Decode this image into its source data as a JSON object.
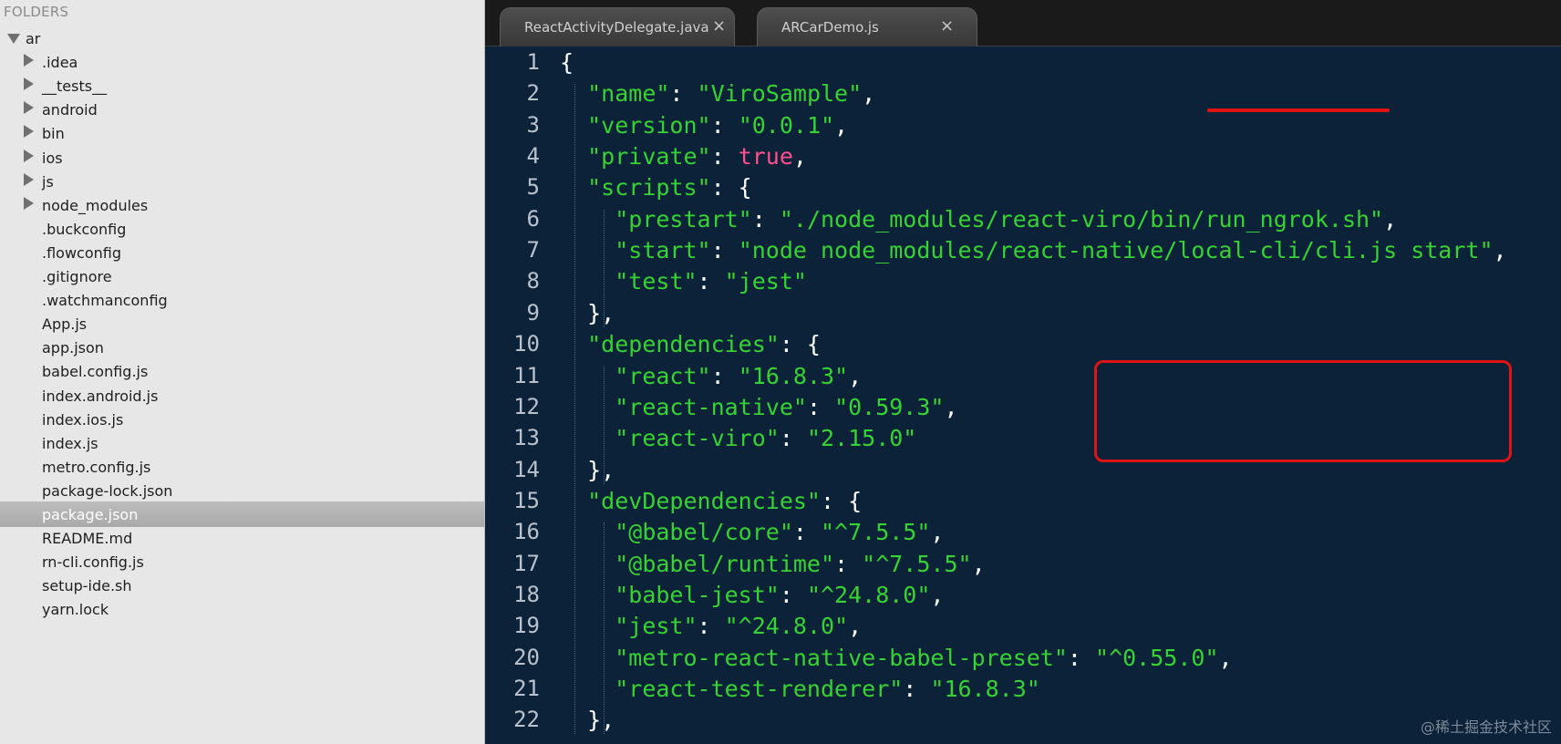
{
  "sidebar": {
    "header": "FOLDERS",
    "root": "ar",
    "folders": [
      ".idea",
      "__tests__",
      "android",
      "bin",
      "ios",
      "js",
      "node_modules"
    ],
    "files": [
      ".buckconfig",
      ".flowconfig",
      ".gitignore",
      ".watchmanconfig",
      "App.js",
      "app.json",
      "babel.config.js",
      "index.android.js",
      "index.ios.js",
      "index.js",
      "metro.config.js",
      "package-lock.json",
      "package.json",
      "README.md",
      "rn-cli.config.js",
      "setup-ide.sh",
      "yarn.lock"
    ],
    "selected_file": "package.json"
  },
  "tabs": [
    {
      "label": "ReactActivityDelegate.java",
      "close": "×",
      "active": false
    },
    {
      "label": "ARCarDemo.js",
      "close": "×",
      "active": false
    }
  ],
  "code": {
    "lines": [
      {
        "n": "1",
        "tokens": [
          [
            "p",
            "{"
          ]
        ]
      },
      {
        "n": "2",
        "tokens": [
          [
            "p",
            "  "
          ],
          [
            "s",
            "\"name\""
          ],
          [
            "p",
            ": "
          ],
          [
            "s",
            "\"ViroSample\""
          ],
          [
            "p",
            ","
          ]
        ]
      },
      {
        "n": "3",
        "tokens": [
          [
            "p",
            "  "
          ],
          [
            "s",
            "\"version\""
          ],
          [
            "p",
            ": "
          ],
          [
            "s",
            "\"0.0.1\""
          ],
          [
            "p",
            ","
          ]
        ]
      },
      {
        "n": "4",
        "tokens": [
          [
            "p",
            "  "
          ],
          [
            "s",
            "\"private\""
          ],
          [
            "p",
            ": "
          ],
          [
            "k",
            "true"
          ],
          [
            "p",
            ","
          ]
        ]
      },
      {
        "n": "5",
        "tokens": [
          [
            "p",
            "  "
          ],
          [
            "s",
            "\"scripts\""
          ],
          [
            "p",
            ": {"
          ]
        ]
      },
      {
        "n": "6",
        "tokens": [
          [
            "p",
            "    "
          ],
          [
            "s",
            "\"prestart\""
          ],
          [
            "p",
            ": "
          ],
          [
            "s",
            "\"./node_modules/react-viro/bin/run_ngrok.sh\""
          ],
          [
            "p",
            ","
          ]
        ]
      },
      {
        "n": "7",
        "tokens": [
          [
            "p",
            "    "
          ],
          [
            "s",
            "\"start\""
          ],
          [
            "p",
            ": "
          ],
          [
            "s",
            "\"node node_modules/react-native/local-cli/cli.js start\""
          ],
          [
            "p",
            ","
          ]
        ]
      },
      {
        "n": "8",
        "tokens": [
          [
            "p",
            "    "
          ],
          [
            "s",
            "\"test\""
          ],
          [
            "p",
            ": "
          ],
          [
            "s",
            "\"jest\""
          ]
        ]
      },
      {
        "n": "9",
        "tokens": [
          [
            "p",
            "  },"
          ]
        ]
      },
      {
        "n": "10",
        "tokens": [
          [
            "p",
            "  "
          ],
          [
            "s",
            "\"dependencies\""
          ],
          [
            "p",
            ": {"
          ]
        ]
      },
      {
        "n": "11",
        "tokens": [
          [
            "p",
            "    "
          ],
          [
            "s",
            "\"react\""
          ],
          [
            "p",
            ": "
          ],
          [
            "s",
            "\"16.8.3\""
          ],
          [
            "p",
            ","
          ]
        ]
      },
      {
        "n": "12",
        "tokens": [
          [
            "p",
            "    "
          ],
          [
            "s",
            "\"react-native\""
          ],
          [
            "p",
            ": "
          ],
          [
            "s",
            "\"0.59.3\""
          ],
          [
            "p",
            ","
          ]
        ]
      },
      {
        "n": "13",
        "tokens": [
          [
            "p",
            "    "
          ],
          [
            "s",
            "\"react-viro\""
          ],
          [
            "p",
            ": "
          ],
          [
            "s",
            "\"2.15.0\""
          ]
        ]
      },
      {
        "n": "14",
        "tokens": [
          [
            "p",
            "  },"
          ]
        ]
      },
      {
        "n": "15",
        "tokens": [
          [
            "p",
            "  "
          ],
          [
            "s",
            "\"devDependencies\""
          ],
          [
            "p",
            ": {"
          ]
        ]
      },
      {
        "n": "16",
        "tokens": [
          [
            "p",
            "    "
          ],
          [
            "s",
            "\"@babel/core\""
          ],
          [
            "p",
            ": "
          ],
          [
            "s",
            "\"^7.5.5\""
          ],
          [
            "p",
            ","
          ]
        ]
      },
      {
        "n": "17",
        "tokens": [
          [
            "p",
            "    "
          ],
          [
            "s",
            "\"@babel/runtime\""
          ],
          [
            "p",
            ": "
          ],
          [
            "s",
            "\"^7.5.5\""
          ],
          [
            "p",
            ","
          ]
        ]
      },
      {
        "n": "18",
        "tokens": [
          [
            "p",
            "    "
          ],
          [
            "s",
            "\"babel-jest\""
          ],
          [
            "p",
            ": "
          ],
          [
            "s",
            "\"^24.8.0\""
          ],
          [
            "p",
            ","
          ]
        ]
      },
      {
        "n": "19",
        "tokens": [
          [
            "p",
            "    "
          ],
          [
            "s",
            "\"jest\""
          ],
          [
            "p",
            ": "
          ],
          [
            "s",
            "\"^24.8.0\""
          ],
          [
            "p",
            ","
          ]
        ]
      },
      {
        "n": "20",
        "tokens": [
          [
            "p",
            "    "
          ],
          [
            "s",
            "\"metro-react-native-babel-preset\""
          ],
          [
            "p",
            ": "
          ],
          [
            "s",
            "\"^0.55.0\""
          ],
          [
            "p",
            ","
          ]
        ]
      },
      {
        "n": "21",
        "tokens": [
          [
            "p",
            "    "
          ],
          [
            "s",
            "\"react-test-renderer\""
          ],
          [
            "p",
            ": "
          ],
          [
            "s",
            "\"16.8.3\""
          ]
        ]
      },
      {
        "n": "22",
        "tokens": [
          [
            "p",
            "  },"
          ]
        ]
      }
    ]
  },
  "watermark": "@稀土掘金技术社区",
  "colors": {
    "string": "#37d233",
    "keyword": "#ff4f8d",
    "editor_bg": "#0b2239",
    "annotation": "#e01414"
  }
}
